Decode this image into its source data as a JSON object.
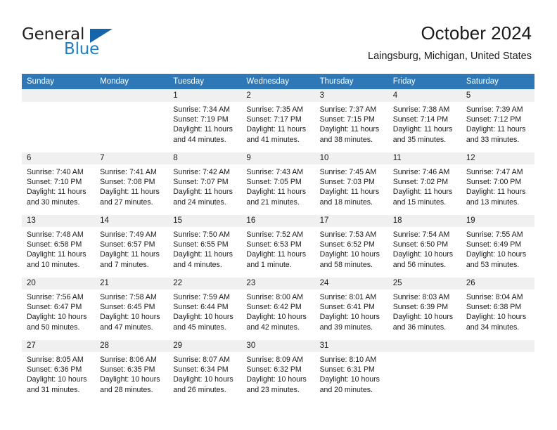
{
  "brand": {
    "name_part1": "General",
    "name_part2": "Blue",
    "triangle_color": "#1665a8",
    "blue_color": "#1f7fc4"
  },
  "header": {
    "title": "October 2024",
    "subtitle": "Laingsburg, Michigan, United States",
    "header_bg": "#2e78b8",
    "daynum_bg": "#f0f0f0"
  },
  "weekdays": [
    "Sunday",
    "Monday",
    "Tuesday",
    "Wednesday",
    "Thursday",
    "Friday",
    "Saturday"
  ],
  "weeks": [
    [
      {
        "day": "",
        "sunrise": "",
        "sunset": "",
        "daylight_line1": "",
        "daylight_line2": ""
      },
      {
        "day": "",
        "sunrise": "",
        "sunset": "",
        "daylight_line1": "",
        "daylight_line2": ""
      },
      {
        "day": "1",
        "sunrise": "Sunrise: 7:34 AM",
        "sunset": "Sunset: 7:19 PM",
        "daylight_line1": "Daylight: 11 hours",
        "daylight_line2": "and 44 minutes."
      },
      {
        "day": "2",
        "sunrise": "Sunrise: 7:35 AM",
        "sunset": "Sunset: 7:17 PM",
        "daylight_line1": "Daylight: 11 hours",
        "daylight_line2": "and 41 minutes."
      },
      {
        "day": "3",
        "sunrise": "Sunrise: 7:37 AM",
        "sunset": "Sunset: 7:15 PM",
        "daylight_line1": "Daylight: 11 hours",
        "daylight_line2": "and 38 minutes."
      },
      {
        "day": "4",
        "sunrise": "Sunrise: 7:38 AM",
        "sunset": "Sunset: 7:14 PM",
        "daylight_line1": "Daylight: 11 hours",
        "daylight_line2": "and 35 minutes."
      },
      {
        "day": "5",
        "sunrise": "Sunrise: 7:39 AM",
        "sunset": "Sunset: 7:12 PM",
        "daylight_line1": "Daylight: 11 hours",
        "daylight_line2": "and 33 minutes."
      }
    ],
    [
      {
        "day": "6",
        "sunrise": "Sunrise: 7:40 AM",
        "sunset": "Sunset: 7:10 PM",
        "daylight_line1": "Daylight: 11 hours",
        "daylight_line2": "and 30 minutes."
      },
      {
        "day": "7",
        "sunrise": "Sunrise: 7:41 AM",
        "sunset": "Sunset: 7:08 PM",
        "daylight_line1": "Daylight: 11 hours",
        "daylight_line2": "and 27 minutes."
      },
      {
        "day": "8",
        "sunrise": "Sunrise: 7:42 AM",
        "sunset": "Sunset: 7:07 PM",
        "daylight_line1": "Daylight: 11 hours",
        "daylight_line2": "and 24 minutes."
      },
      {
        "day": "9",
        "sunrise": "Sunrise: 7:43 AM",
        "sunset": "Sunset: 7:05 PM",
        "daylight_line1": "Daylight: 11 hours",
        "daylight_line2": "and 21 minutes."
      },
      {
        "day": "10",
        "sunrise": "Sunrise: 7:45 AM",
        "sunset": "Sunset: 7:03 PM",
        "daylight_line1": "Daylight: 11 hours",
        "daylight_line2": "and 18 minutes."
      },
      {
        "day": "11",
        "sunrise": "Sunrise: 7:46 AM",
        "sunset": "Sunset: 7:02 PM",
        "daylight_line1": "Daylight: 11 hours",
        "daylight_line2": "and 15 minutes."
      },
      {
        "day": "12",
        "sunrise": "Sunrise: 7:47 AM",
        "sunset": "Sunset: 7:00 PM",
        "daylight_line1": "Daylight: 11 hours",
        "daylight_line2": "and 13 minutes."
      }
    ],
    [
      {
        "day": "13",
        "sunrise": "Sunrise: 7:48 AM",
        "sunset": "Sunset: 6:58 PM",
        "daylight_line1": "Daylight: 11 hours",
        "daylight_line2": "and 10 minutes."
      },
      {
        "day": "14",
        "sunrise": "Sunrise: 7:49 AM",
        "sunset": "Sunset: 6:57 PM",
        "daylight_line1": "Daylight: 11 hours",
        "daylight_line2": "and 7 minutes."
      },
      {
        "day": "15",
        "sunrise": "Sunrise: 7:50 AM",
        "sunset": "Sunset: 6:55 PM",
        "daylight_line1": "Daylight: 11 hours",
        "daylight_line2": "and 4 minutes."
      },
      {
        "day": "16",
        "sunrise": "Sunrise: 7:52 AM",
        "sunset": "Sunset: 6:53 PM",
        "daylight_line1": "Daylight: 11 hours",
        "daylight_line2": "and 1 minute."
      },
      {
        "day": "17",
        "sunrise": "Sunrise: 7:53 AM",
        "sunset": "Sunset: 6:52 PM",
        "daylight_line1": "Daylight: 10 hours",
        "daylight_line2": "and 58 minutes."
      },
      {
        "day": "18",
        "sunrise": "Sunrise: 7:54 AM",
        "sunset": "Sunset: 6:50 PM",
        "daylight_line1": "Daylight: 10 hours",
        "daylight_line2": "and 56 minutes."
      },
      {
        "day": "19",
        "sunrise": "Sunrise: 7:55 AM",
        "sunset": "Sunset: 6:49 PM",
        "daylight_line1": "Daylight: 10 hours",
        "daylight_line2": "and 53 minutes."
      }
    ],
    [
      {
        "day": "20",
        "sunrise": "Sunrise: 7:56 AM",
        "sunset": "Sunset: 6:47 PM",
        "daylight_line1": "Daylight: 10 hours",
        "daylight_line2": "and 50 minutes."
      },
      {
        "day": "21",
        "sunrise": "Sunrise: 7:58 AM",
        "sunset": "Sunset: 6:45 PM",
        "daylight_line1": "Daylight: 10 hours",
        "daylight_line2": "and 47 minutes."
      },
      {
        "day": "22",
        "sunrise": "Sunrise: 7:59 AM",
        "sunset": "Sunset: 6:44 PM",
        "daylight_line1": "Daylight: 10 hours",
        "daylight_line2": "and 45 minutes."
      },
      {
        "day": "23",
        "sunrise": "Sunrise: 8:00 AM",
        "sunset": "Sunset: 6:42 PM",
        "daylight_line1": "Daylight: 10 hours",
        "daylight_line2": "and 42 minutes."
      },
      {
        "day": "24",
        "sunrise": "Sunrise: 8:01 AM",
        "sunset": "Sunset: 6:41 PM",
        "daylight_line1": "Daylight: 10 hours",
        "daylight_line2": "and 39 minutes."
      },
      {
        "day": "25",
        "sunrise": "Sunrise: 8:03 AM",
        "sunset": "Sunset: 6:39 PM",
        "daylight_line1": "Daylight: 10 hours",
        "daylight_line2": "and 36 minutes."
      },
      {
        "day": "26",
        "sunrise": "Sunrise: 8:04 AM",
        "sunset": "Sunset: 6:38 PM",
        "daylight_line1": "Daylight: 10 hours",
        "daylight_line2": "and 34 minutes."
      }
    ],
    [
      {
        "day": "27",
        "sunrise": "Sunrise: 8:05 AM",
        "sunset": "Sunset: 6:36 PM",
        "daylight_line1": "Daylight: 10 hours",
        "daylight_line2": "and 31 minutes."
      },
      {
        "day": "28",
        "sunrise": "Sunrise: 8:06 AM",
        "sunset": "Sunset: 6:35 PM",
        "daylight_line1": "Daylight: 10 hours",
        "daylight_line2": "and 28 minutes."
      },
      {
        "day": "29",
        "sunrise": "Sunrise: 8:07 AM",
        "sunset": "Sunset: 6:34 PM",
        "daylight_line1": "Daylight: 10 hours",
        "daylight_line2": "and 26 minutes."
      },
      {
        "day": "30",
        "sunrise": "Sunrise: 8:09 AM",
        "sunset": "Sunset: 6:32 PM",
        "daylight_line1": "Daylight: 10 hours",
        "daylight_line2": "and 23 minutes."
      },
      {
        "day": "31",
        "sunrise": "Sunrise: 8:10 AM",
        "sunset": "Sunset: 6:31 PM",
        "daylight_line1": "Daylight: 10 hours",
        "daylight_line2": "and 20 minutes."
      },
      {
        "day": "",
        "sunrise": "",
        "sunset": "",
        "daylight_line1": "",
        "daylight_line2": ""
      },
      {
        "day": "",
        "sunrise": "",
        "sunset": "",
        "daylight_line1": "",
        "daylight_line2": ""
      }
    ]
  ]
}
